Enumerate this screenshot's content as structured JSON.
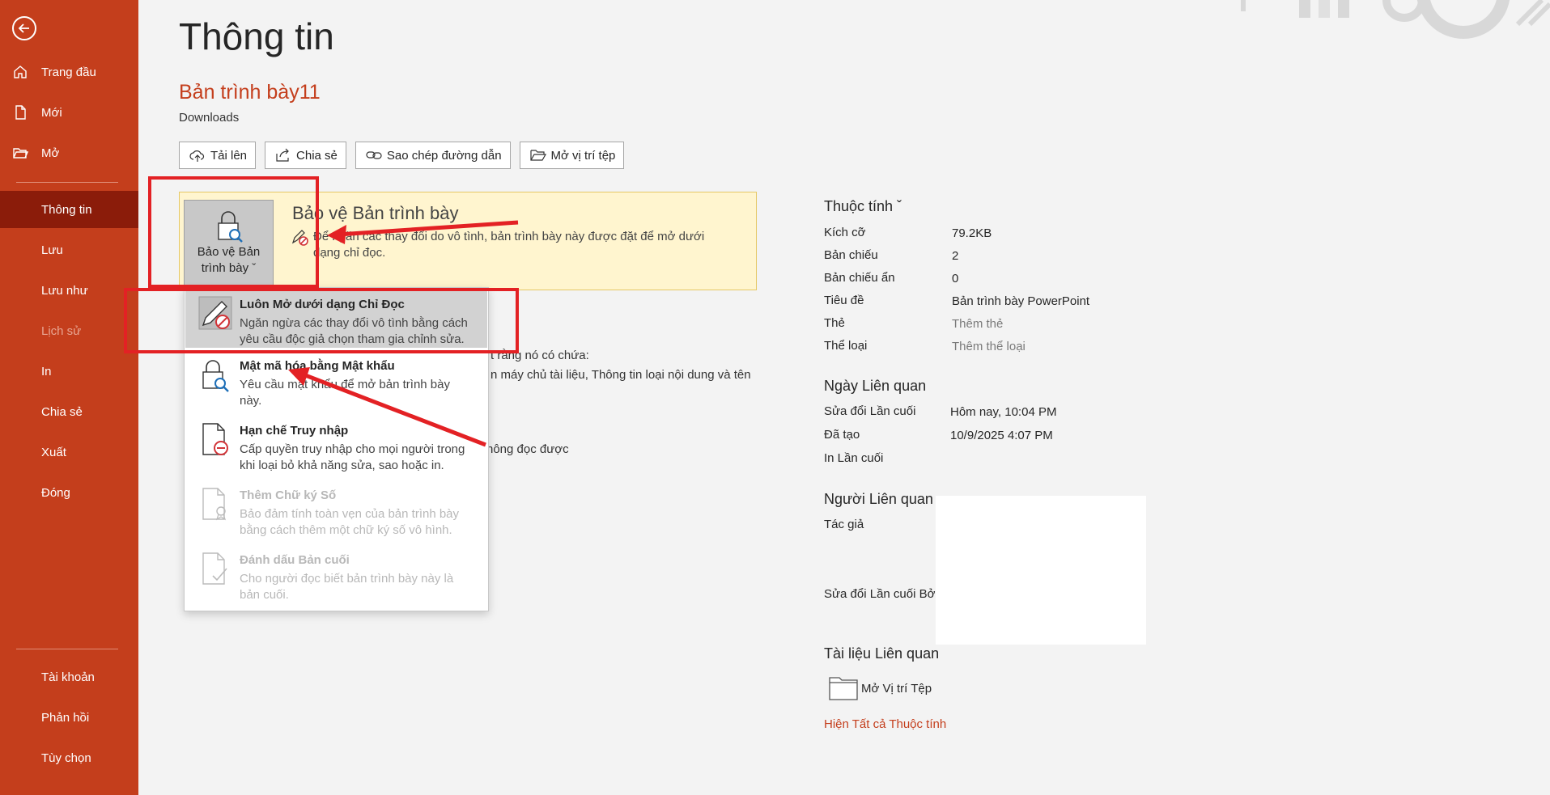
{
  "sidebar": {
    "items": [
      {
        "label": "Trang đầu",
        "icon": "home-icon"
      },
      {
        "label": "Mới",
        "icon": "new-document-icon"
      },
      {
        "label": "Mở",
        "icon": "open-folder-icon"
      },
      {
        "label": "Thông tin",
        "active": true
      },
      {
        "label": "Lưu"
      },
      {
        "label": "Lưu như"
      },
      {
        "label": "Lịch sử",
        "disabled": true
      },
      {
        "label": "In"
      },
      {
        "label": "Chia sẻ"
      },
      {
        "label": "Xuất"
      },
      {
        "label": "Đóng"
      }
    ],
    "bottom_items": [
      {
        "label": "Tài khoản"
      },
      {
        "label": "Phản hồi"
      },
      {
        "label": "Tùy chọn"
      }
    ]
  },
  "header": {
    "title": "Thông tin",
    "document_name": "Bản trình bày11",
    "location": "Downloads"
  },
  "actions": [
    {
      "label": "Tải lên",
      "icon": "cloud-upload-icon"
    },
    {
      "label": "Chia sẻ",
      "icon": "share-icon"
    },
    {
      "label": "Sao chép đường dẫn",
      "icon": "link-icon"
    },
    {
      "label": "Mở vị trí tệp",
      "icon": "folder-open-icon"
    }
  ],
  "protect": {
    "tile_line1": "Bảo vệ Bản",
    "tile_line2": "trình bày ˇ",
    "heading": "Bảo vệ Bản trình bày",
    "description": "Để ngăn các thay đổi do vô tình, bản trình bày này được đặt để mở dưới dạng chỉ đọc."
  },
  "background_texts": {
    "inspect_partial": "t rằng nó có chứa:",
    "inspect_partial2": "n máy chủ tài liệu, Thông tin loại nội dung và tên",
    "versions_partial": "hông đọc được"
  },
  "dropdown": [
    {
      "title": "Luôn Mở dưới dạng Chỉ Đọc",
      "description": "Ngăn ngừa các thay đổi vô tình bằng cách yêu cầu độc giả chọn tham gia chỉnh sửa.",
      "icon": "pencil-forbidden-icon",
      "highlighted": true
    },
    {
      "title": "Mật mã hóa bằng Mật khẩu",
      "description": "Yêu cầu mật khẩu để mở bản trình bày này.",
      "icon": "lock-search-icon"
    },
    {
      "title": "Hạn chế Truy nhập",
      "description": "Cấp quyền truy nhập cho mọi người trong khi loại bỏ khả năng sửa, sao hoặc in.",
      "icon": "document-restrict-icon"
    },
    {
      "title": "Thêm Chữ ký Số",
      "description": "Bảo đảm tính toàn vẹn của bản trình bày bằng cách thêm một chữ ký số vô hình.",
      "icon": "document-signature-icon",
      "disabled": true
    },
    {
      "title": "Đánh dấu Bản cuối",
      "description": "Cho người đọc biết bản trình bày này là bản cuối.",
      "icon": "document-final-icon",
      "disabled": true
    }
  ],
  "properties": {
    "heading": "Thuộc tính ˇ",
    "rows": [
      {
        "label": "Kích cỡ",
        "value": "79.2KB"
      },
      {
        "label": "Bản chiếu",
        "value": "2"
      },
      {
        "label": "Bản chiếu ẩn",
        "value": "0"
      },
      {
        "label": "Tiêu đề",
        "value": "Bản trình bày PowerPoint"
      },
      {
        "label": "Thẻ",
        "value": "Thêm thẻ",
        "muted": true
      },
      {
        "label": "Thể loại",
        "value": "Thêm thể loại",
        "muted": true
      }
    ]
  },
  "related_dates": {
    "heading": "Ngày Liên quan",
    "rows": [
      {
        "label": "Sửa đổi Lần cuối",
        "value": "Hôm nay, 10:04 PM"
      },
      {
        "label": "Đã tạo",
        "value": "10/9/2025 4:07 PM"
      },
      {
        "label": "In Lần cuối",
        "value": ""
      }
    ]
  },
  "related_people": {
    "heading": "Người Liên quan",
    "author_label": "Tác giả",
    "modified_by_label": "Sửa đổi Lần cuối Bởi"
  },
  "related_docs": {
    "heading": "Tài liệu Liên quan",
    "open_location": "Mở Vị trí Tệp",
    "show_all": "Hiện Tất cả Thuộc tính"
  },
  "colors": {
    "accent": "#c43e1c",
    "sidebar_active": "#8b1c0a",
    "annotation": "#e32124",
    "protect_bg": "#fff5cf"
  }
}
